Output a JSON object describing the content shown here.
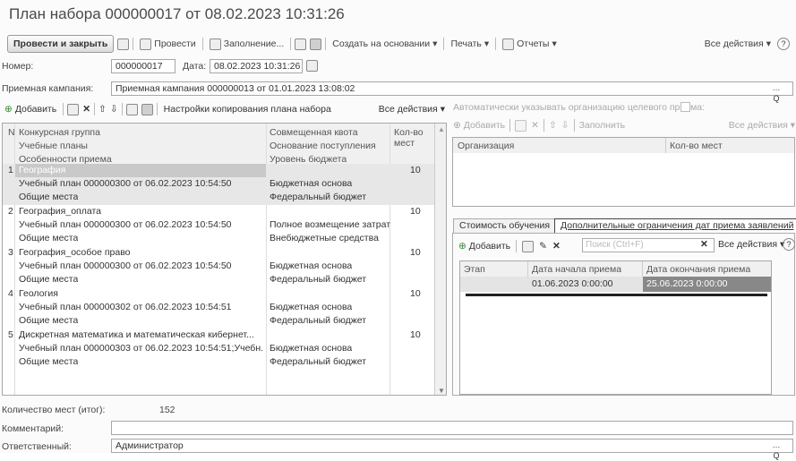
{
  "title": "План набора 000000017 от 08.02.2023 10:31:26",
  "toolbar": {
    "post_close": "Провести и закрыть",
    "post": "Провести",
    "fill": "Заполнение...",
    "create_based": "Создать на основании",
    "print": "Печать",
    "reports": "Отчеты",
    "all_actions": "Все действия",
    "help": "?"
  },
  "form": {
    "number_label": "Номер:",
    "number": "000000017",
    "date_label": "Дата:",
    "date": "08.02.2023 10:31:26",
    "campaign_label": "Приемная кампания:",
    "campaign": "Приемная кампания 000000013 от 01.01.2023 13:08:02",
    "total_label": "Количество мест (итог):",
    "total": "152",
    "comment_label": "Комментарий:",
    "comment": "",
    "resp_label": "Ответственный:",
    "resp": "Администратор"
  },
  "left": {
    "add": "Добавить",
    "copy_settings": "Настройки копирования плана набора",
    "all_actions": "Все действия",
    "headers": {
      "n": "N",
      "group": "Конкурсная группа",
      "plans": "Учебные планы",
      "features": "Особенности приема",
      "quota": "Совмещенная квота",
      "basis": "Основание поступления",
      "budget": "Уровень бюджета",
      "count": "Кол-во мест"
    },
    "rows": [
      {
        "n": "1",
        "group": "География",
        "plan": "Учебный план 000000300 от 06.02.2023 10:54:50",
        "feat": "Общие места",
        "quota": "",
        "basis": "Бюджетная основа",
        "budget": "Федеральный бюджет",
        "count": "10"
      },
      {
        "n": "2",
        "group": "География_оплата",
        "plan": "Учебный план 000000300 от 06.02.2023 10:54:50",
        "feat": "Общие места",
        "quota": "",
        "basis": "Полное возмещение затрат",
        "budget": "Внебюджетные средства",
        "count": "10"
      },
      {
        "n": "3",
        "group": "География_особое право",
        "plan": "Учебный план 000000300 от 06.02.2023 10:54:50",
        "feat": "Общие места",
        "quota": "",
        "basis": "Бюджетная основа",
        "budget": "Федеральный бюджет",
        "count": "10"
      },
      {
        "n": "4",
        "group": "Геология",
        "plan": "Учебный план 000000302 от 06.02.2023 10:54:51",
        "feat": "Общие места",
        "quota": "",
        "basis": "Бюджетная основа",
        "budget": "Федеральный бюджет",
        "count": "10"
      },
      {
        "n": "5",
        "group": "Дискретная математика и математическая кибернет...",
        "plan": "Учебный план 000000303 от 06.02.2023 10:54:51;Учебн...",
        "feat": "Общие места",
        "quota": "",
        "basis": "Бюджетная основа",
        "budget": "Федеральный бюджет",
        "count": "10"
      }
    ]
  },
  "right": {
    "auto_label": "Автоматически указывать организацию целевого приема:",
    "add": "Добавить",
    "fill": "Заполнить",
    "all_actions": "Все действия",
    "org_header": "Организация",
    "count_header": "Кол-во мест",
    "tab1": "Стоимость обучения",
    "tab2": "Дополнительные ограничения дат приема заявлений",
    "sub": {
      "add": "Добавить",
      "search": "Поиск (Ctrl+F)",
      "all_actions": "Все действия",
      "help": "?",
      "h_stage": "Этап",
      "h_start": "Дата начала приема",
      "h_end": "Дата окончания приема",
      "stage": "",
      "start": "01.06.2023 0:00:00",
      "end": "25.06.2023 0:00:00"
    }
  }
}
